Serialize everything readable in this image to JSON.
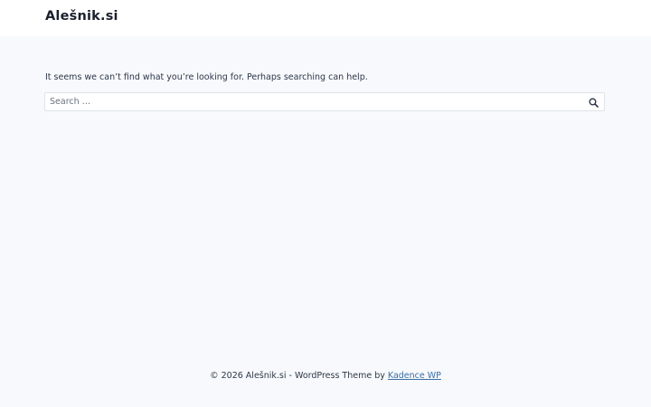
{
  "header": {
    "site_title": "Alešnik.si"
  },
  "main": {
    "message": "It seems we can’t find what you’re looking for. Perhaps searching can help.",
    "search": {
      "placeholder": "Search …",
      "value": "",
      "icon": "search-icon"
    }
  },
  "footer": {
    "copyright_text": "© 2026 Alešnik.si - WordPress Theme by ",
    "theme_link_label": "Kadence WP"
  },
  "colors": {
    "page_background": "#f7f9fc",
    "header_background": "#ffffff",
    "text": "#2d3748",
    "link": "#3b6ea5"
  }
}
